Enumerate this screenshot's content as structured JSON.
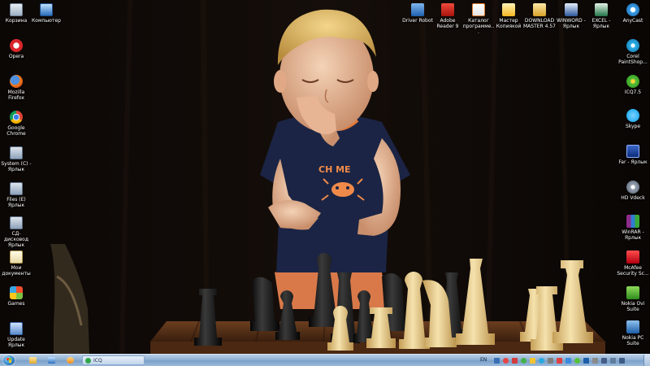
{
  "desktop": {
    "left_icons": [
      {
        "label": "Корзина",
        "icon": "recycle-bin-icon"
      },
      {
        "label": "Opera",
        "icon": "opera-icon"
      },
      {
        "label": "Mozilla\nFirefox",
        "icon": "firefox-icon"
      },
      {
        "label": "Google\nChrome",
        "icon": "chrome-icon"
      },
      {
        "label": "System (C) -\nЯрлык",
        "icon": "drive-c-icon"
      },
      {
        "label": "Files (E)\nЯрлык",
        "icon": "drive-e-icon"
      },
      {
        "label": "СД-дисковод\nЯрлык",
        "icon": "cd-drive-icon"
      },
      {
        "label": "Мои\nдокументы",
        "icon": "documents-icon"
      },
      {
        "label": "Games",
        "icon": "games-icon"
      },
      {
        "label": "Update\nЯрлык",
        "icon": "update-icon"
      }
    ],
    "computer_icon": {
      "label": "Компьютер",
      "icon": "computer-icon"
    },
    "top_icons": [
      {
        "label": "Driver Robot",
        "icon": "driver-robot-icon"
      },
      {
        "label": "Adobe\nReader 9",
        "icon": "adobe-reader-icon"
      },
      {
        "label": "Каталог\nпрограмме...",
        "icon": "catalog-icon"
      },
      {
        "label": "Мастер\nКопиякой",
        "icon": "wizard-icon"
      },
      {
        "label": "DOWNLOAD\nMASTER 4.57",
        "icon": "download-master-icon"
      },
      {
        "label": "WINWORD -\nЯрлык",
        "icon": "winword-icon"
      },
      {
        "label": "EXCEL -\nЯрлык",
        "icon": "excel-icon"
      }
    ],
    "right_icons": [
      {
        "label": "AnyCast",
        "icon": "anycast-icon"
      },
      {
        "label": "Corel\nPaintShop...",
        "icon": "corel-icon"
      },
      {
        "label": "ICQ7.5",
        "icon": "icq-icon"
      },
      {
        "label": "Skype",
        "icon": "skype-icon"
      },
      {
        "label": "Far - Ярлык",
        "icon": "far-icon"
      },
      {
        "label": "HD Vdeck",
        "icon": "hdvdeck-icon"
      },
      {
        "label": "WinRAR -\nЯрлык",
        "icon": "winrar-icon"
      },
      {
        "label": "McAfee\nSecurity Sc...",
        "icon": "mcafee-icon"
      },
      {
        "label": "Nokia Ovi\nSuite",
        "icon": "nokia-ovi-icon"
      },
      {
        "label": "Nokia PC\nSuite",
        "icon": "nokia-pc-icon"
      }
    ]
  },
  "taskbar": {
    "quick_launch": [
      "folder-icon",
      "explorer-icon",
      "media-icon"
    ],
    "window_button": {
      "label": "ICQ",
      "icon": "icq-icon"
    },
    "language": "EN",
    "tray_icons": [
      "tray-icon-1",
      "tray-icon-2",
      "tray-icon-3",
      "tray-icon-4",
      "tray-icon-5",
      "tray-icon-6",
      "tray-icon-7",
      "tray-icon-8",
      "tray-icon-9",
      "tray-icon-10",
      "tray-icon-11",
      "tray-icon-12",
      "tray-icon-13",
      "tray-icon-14",
      "tray-icon-15"
    ]
  },
  "wallpaper": {
    "shirt_text": "CH ME"
  }
}
